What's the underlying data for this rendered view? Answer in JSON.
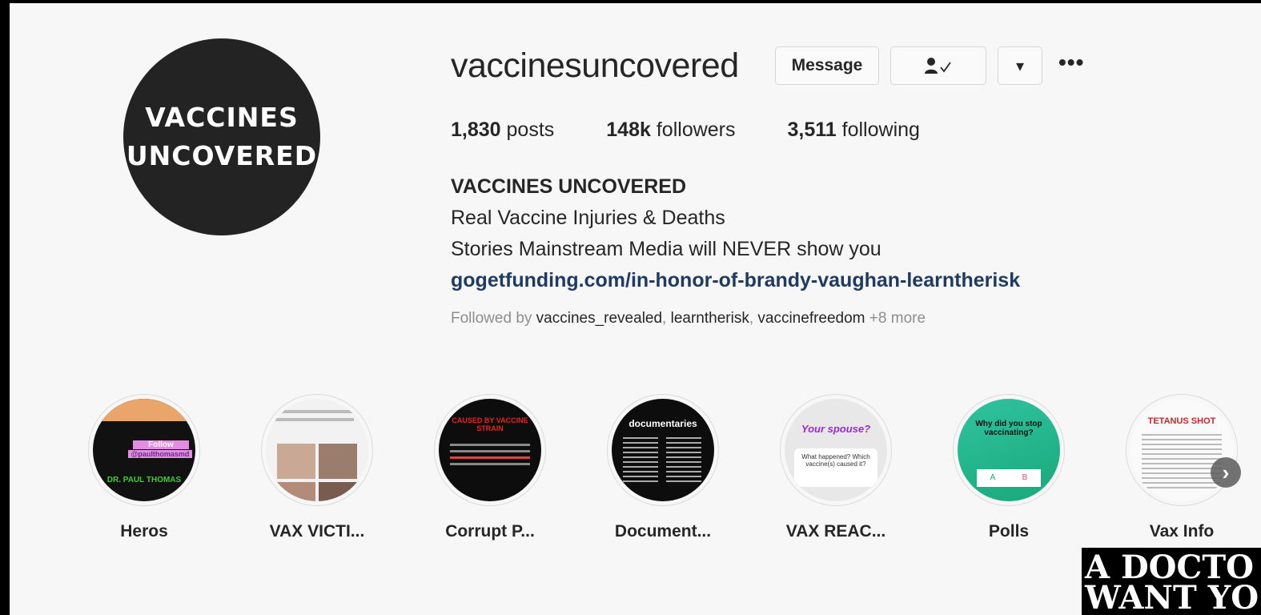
{
  "profile": {
    "avatar_line1": "VACCINES",
    "avatar_line2": "UNCOVERED",
    "username": "vaccinesuncovered",
    "message_label": "Message",
    "more_label": "•••",
    "dropdown_glyph": "▾",
    "stats": [
      {
        "count": "1,830",
        "label": "posts"
      },
      {
        "count": "148k",
        "label": "followers"
      },
      {
        "count": "3,511",
        "label": "following"
      }
    ],
    "bio": {
      "name": "VACCINES UNCOVERED",
      "line1": "Real Vaccine Injuries & Deaths",
      "line2": "Stories Mainstream Media will NEVER show you",
      "link": "gogetfunding.com/in-honor-of-brandy-vaughan-learntherisk"
    },
    "followed_by": {
      "prefix": "Followed by ",
      "accounts": [
        "vaccines_revealed",
        "learntherisk",
        "vaccinefreedom"
      ],
      "suffix": " +8 more"
    }
  },
  "highlights": [
    {
      "label": "Heros",
      "thumb_text1": "Follow",
      "thumb_text2": "@paulthomasmd",
      "thumb_text3": "DR. PAUL THOMAS"
    },
    {
      "label": "VAX VICTI..."
    },
    {
      "label": "Corrupt P...",
      "thumb_text1": "CAUSED BY VACCINE STRAIN"
    },
    {
      "label": "Document...",
      "thumb_text1": "documentaries"
    },
    {
      "label": "VAX REAC...",
      "thumb_text1": "Your spouse?",
      "thumb_text2": "What happened? Which vaccine(s) caused it?"
    },
    {
      "label": "Polls",
      "thumb_text1": "Why did you stop vaccinating?",
      "opt_a": "A",
      "opt_b": "B"
    },
    {
      "label": "Vax Info",
      "thumb_text1": "TETANUS SHOT"
    }
  ],
  "corner_image": {
    "line1": "A DOCTO",
    "line2": "WANT YO"
  },
  "colors": {
    "link": "#1f3b63",
    "muted": "#8e8e8e",
    "poll_green": "#21b58a"
  }
}
